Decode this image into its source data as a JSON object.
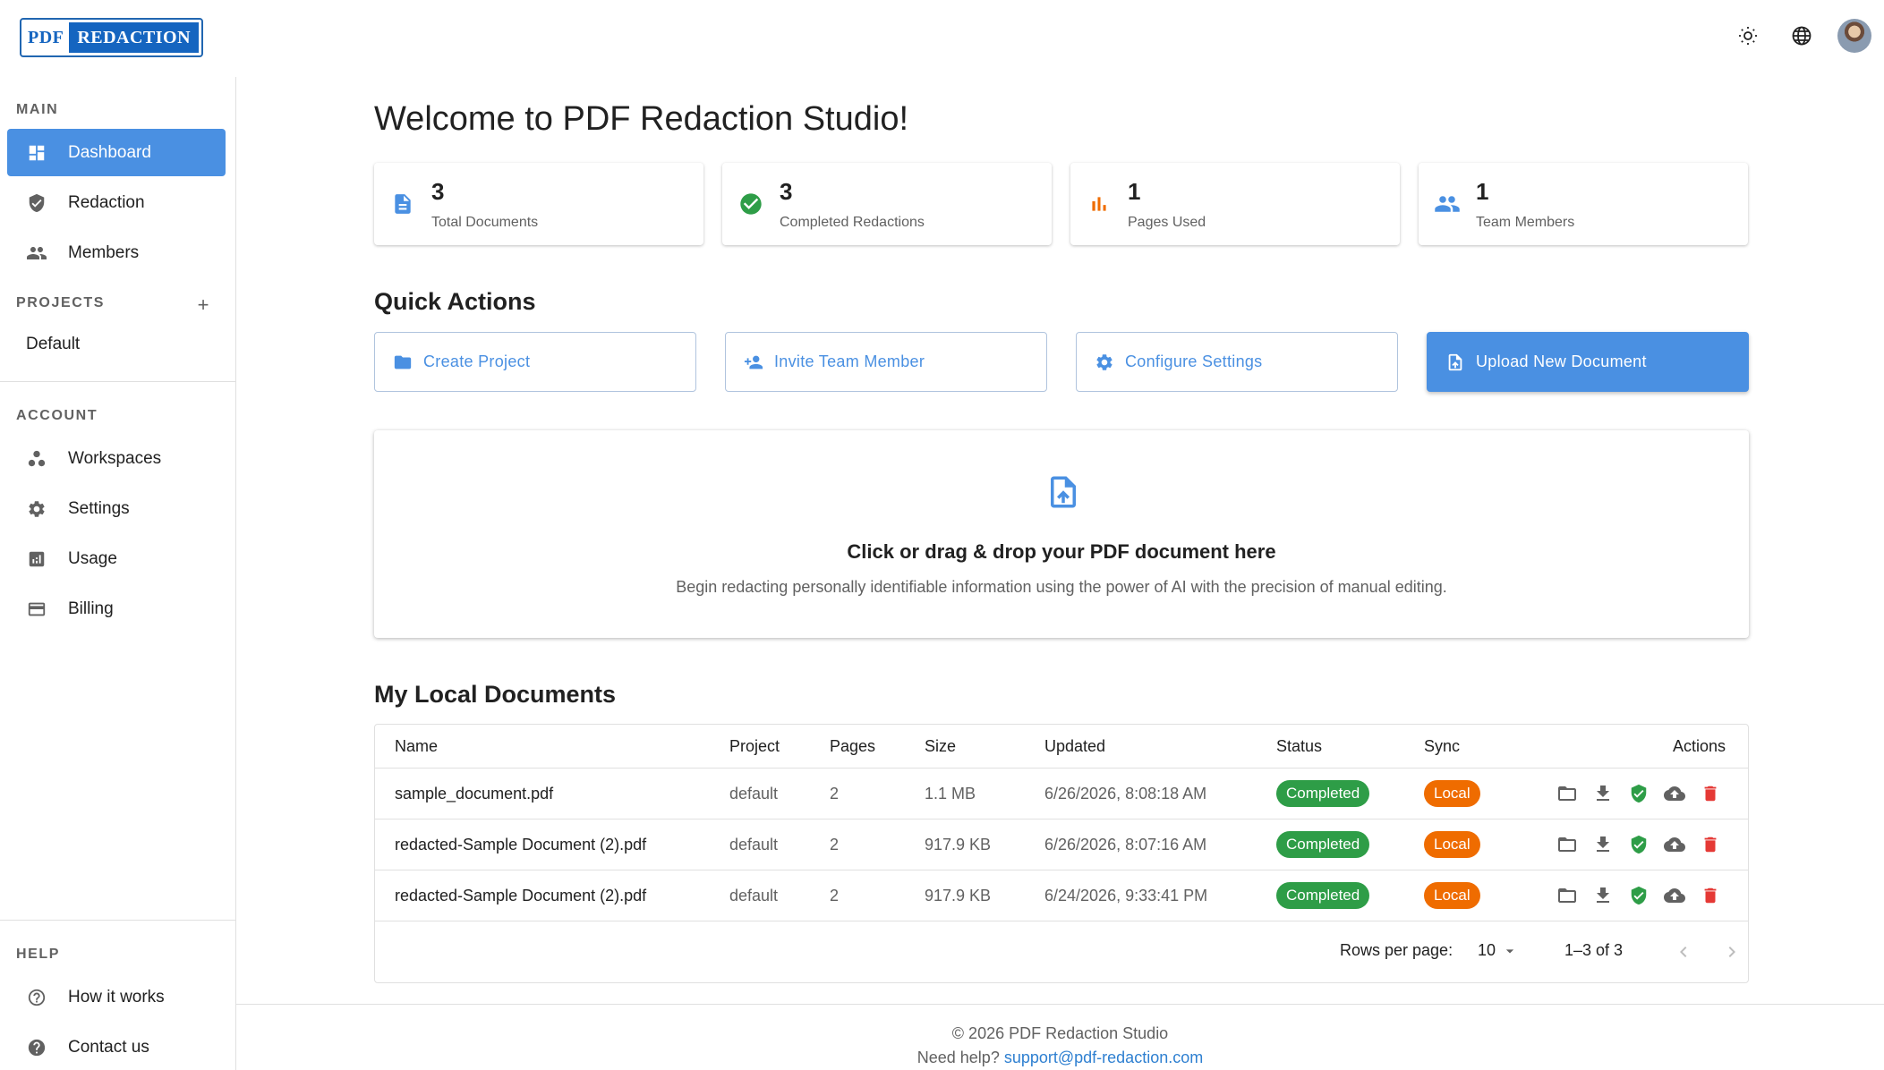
{
  "logo": {
    "part1": "PDF",
    "part2": "REDACTION"
  },
  "colors": {
    "accent": "#4a90e2",
    "success": "#2e9d47",
    "warning": "#ef6c00",
    "danger": "#e53935"
  },
  "sidebar": {
    "main_title": "MAIN",
    "main_items": [
      {
        "label": "Dashboard",
        "icon": "dashboard-icon",
        "active": true
      },
      {
        "label": "Redaction",
        "icon": "shield-icon"
      },
      {
        "label": "Members",
        "icon": "people-icon"
      }
    ],
    "projects_title": "PROJECTS",
    "projects": [
      "Default"
    ],
    "account_title": "ACCOUNT",
    "account_items": [
      {
        "label": "Workspaces",
        "icon": "workspaces-icon"
      },
      {
        "label": "Settings",
        "icon": "gear-icon"
      },
      {
        "label": "Usage",
        "icon": "usage-icon"
      },
      {
        "label": "Billing",
        "icon": "credit-card-icon"
      }
    ],
    "help_title": "HELP",
    "help_items": [
      {
        "label": "How it works",
        "icon": "help-circle-icon"
      },
      {
        "label": "Contact us",
        "icon": "help-filled-icon"
      }
    ]
  },
  "main": {
    "title": "Welcome to PDF Redaction Studio!",
    "stats": [
      {
        "value": "3",
        "label": "Total Documents",
        "icon": "document-icon"
      },
      {
        "value": "3",
        "label": "Completed Redactions",
        "icon": "check-circle-icon"
      },
      {
        "value": "1",
        "label": "Pages Used",
        "icon": "bar-chart-icon"
      },
      {
        "value": "1",
        "label": "Team Members",
        "icon": "people-icon"
      }
    ],
    "quick_actions_title": "Quick Actions",
    "quick_actions": [
      {
        "label": "Create Project",
        "icon": "folder-icon"
      },
      {
        "label": "Invite Team Member",
        "icon": "person-add-icon"
      },
      {
        "label": "Configure Settings",
        "icon": "gear-icon"
      },
      {
        "label": "Upload New Document",
        "icon": "upload-file-icon"
      }
    ],
    "dropzone": {
      "title": "Click or drag & drop your PDF document here",
      "subtitle": "Begin redacting personally identifiable information using the power of AI with the precision of manual editing."
    },
    "documents_title": "My Local Documents",
    "table": {
      "headers": [
        "Name",
        "Project",
        "Pages",
        "Size",
        "Updated",
        "Status",
        "Sync",
        "Actions"
      ],
      "rows": [
        {
          "name": "sample_document.pdf",
          "project": "default",
          "pages": "2",
          "size": "1.1 MB",
          "updated": "6/26/2026, 8:08:18 AM",
          "status": "Completed",
          "sync": "Local"
        },
        {
          "name": "redacted-Sample Document (2).pdf",
          "project": "default",
          "pages": "2",
          "size": "917.9 KB",
          "updated": "6/26/2026, 8:07:16 AM",
          "status": "Completed",
          "sync": "Local"
        },
        {
          "name": "redacted-Sample Document (2).pdf",
          "project": "default",
          "pages": "2",
          "size": "917.9 KB",
          "updated": "6/24/2026, 9:33:41 PM",
          "status": "Completed",
          "sync": "Local"
        }
      ],
      "pagination": {
        "rows_label": "Rows per page:",
        "rows_value": "10",
        "range": "1–3 of 3"
      }
    }
  },
  "footer": {
    "copyright": "© 2026 PDF Redaction Studio",
    "help_prefix": "Need help?",
    "email": "support@pdf-redaction.com"
  }
}
